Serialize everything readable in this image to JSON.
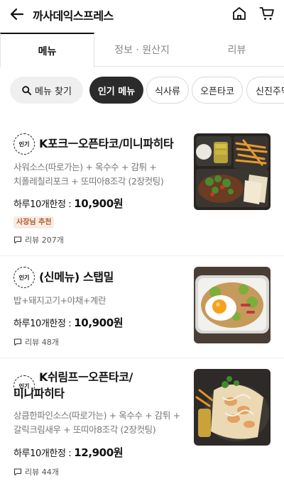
{
  "header": {
    "title": "까사데익스프레스",
    "back_icon": "arrow-left-icon",
    "home_icon": "home-icon",
    "cart_icon": "cart-icon"
  },
  "tabs": [
    {
      "label": "메뉴",
      "active": true
    },
    {
      "label": "정보 · 원산지",
      "active": false
    },
    {
      "label": "리뷰",
      "active": false
    }
  ],
  "chips": {
    "search_label": "메뉴 찾기",
    "categories": [
      "인기 메뉴",
      "식사류",
      "오픈타코",
      "신진주먹"
    ]
  },
  "menu_items": [
    {
      "badge": "인기",
      "name_lines": [
        "K포크ㅡ오픈타코/미니파히타"
      ],
      "desc_lines": [
        "사워소스(따로가는) + 옥수수 + 감튀 +",
        "치폴레칠리포크 + 또띠아8조각 (2장컷팅)"
      ],
      "price_prefix": "하루10개한정 :",
      "price": "10,900원",
      "tag": "사장님 추천",
      "reviews": "리뷰 207개"
    },
    {
      "badge": "인기",
      "name_lines": [
        "(신메뉴) 스탭밀"
      ],
      "desc_lines": [
        "밥+돼지고기+야채+계란"
      ],
      "price_prefix": "하루10개한정 :",
      "price": "10,900원",
      "tag": "",
      "reviews": "리뷰 48개"
    },
    {
      "badge": "인기",
      "name_lines": [
        "K쉬림프ㅡ오픈타코/",
        "미니파히타"
      ],
      "desc_lines": [
        "상큼한파인소스(따로가는) + 옥수수 + 감튀 +",
        "갈릭크림새우 + 또띠아8조각 (2장컷팅)"
      ],
      "price_prefix": "하루10개한정 :",
      "price": "12,900원",
      "tag": "",
      "reviews": "리뷰 44개"
    }
  ],
  "icons": [
    "arrow-left-icon",
    "home-icon",
    "cart-icon",
    "search-icon",
    "review-bubble-icon"
  ],
  "colors": {
    "active_chip_bg": "#2b2b2b",
    "tag_bg": "#f6ece4",
    "tag_text": "#b15a2c",
    "desc_text": "#777777"
  }
}
